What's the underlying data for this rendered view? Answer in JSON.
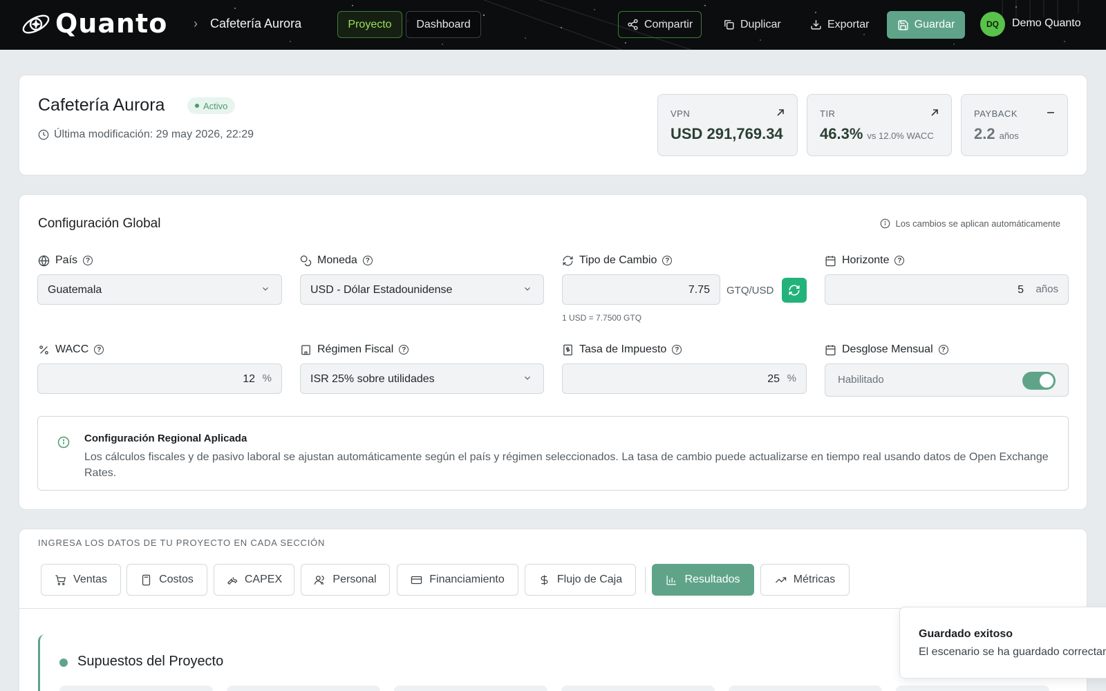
{
  "app": {
    "name": "Quanto",
    "breadcrumb_sep": "›",
    "project_name": "Cafetería Aurora"
  },
  "nav": {
    "project_tab": "Proyecto",
    "dashboard_tab": "Dashboard"
  },
  "toolbar": {
    "share": "Compartir",
    "duplicate": "Duplicar",
    "export": "Exportar",
    "save": "Guardar"
  },
  "user": {
    "initials": "DQ",
    "name": "Demo Quanto"
  },
  "project": {
    "title": "Cafetería Aurora",
    "status": "Activo",
    "last_modified": "Última modificación: 29 may 2026, 22:29"
  },
  "kpis": {
    "vpn": {
      "label": "VPN",
      "value": "USD 291,769.34",
      "icon": "arrow-up-right-icon"
    },
    "tir": {
      "label": "TIR",
      "value": "46.3%",
      "sub": "vs 12.0% WACC",
      "icon": "arrow-up-right-icon"
    },
    "payback": {
      "label": "PAYBACK",
      "value": "2.2",
      "sub": "años",
      "icon": "minus-icon"
    }
  },
  "config": {
    "title": "Configuración Global",
    "auto_note": "Los cambios se aplican automáticamente",
    "country": {
      "label": "País",
      "value": "Guatemala"
    },
    "currency": {
      "label": "Moneda",
      "value": "USD - Dólar Estadounidense"
    },
    "fx": {
      "label": "Tipo de Cambio",
      "value": "7.75",
      "unit": "GTQ/USD",
      "hint": "1 USD = 7.7500 GTQ"
    },
    "horizon": {
      "label": "Horizonte",
      "value": "5",
      "unit": "años"
    },
    "wacc": {
      "label": "WACC",
      "value": "12",
      "unit": "%"
    },
    "tax_regime": {
      "label": "Régimen Fiscal",
      "value": "ISR 25% sobre utilidades"
    },
    "tax_rate": {
      "label": "Tasa de Impuesto",
      "value": "25",
      "unit": "%"
    },
    "monthly": {
      "label": "Desglose Mensual",
      "value": "Habilitado",
      "enabled": true
    }
  },
  "info": {
    "title": "Configuración Regional Aplicada",
    "text": "Los cálculos fiscales y de pasivo laboral se ajustan automáticamente según el país y régimen seleccionados. La tasa de cambio puede actualizarse en tiempo real usando datos de Open Exchange Rates."
  },
  "sections": {
    "caption": "INGRESA LOS DATOS DE TU PROYECTO EN CADA SECCIÓN",
    "tabs": [
      "Ventas",
      "Costos",
      "CAPEX",
      "Personal",
      "Financiamiento",
      "Flujo de Caja",
      "Resultados",
      "Métricas"
    ],
    "active": "Resultados"
  },
  "assumptions": {
    "title": "Supuestos del Proyecto"
  },
  "toast": {
    "title": "Guardado exitoso",
    "text": "El escenario se ha guardado correctamente"
  },
  "colors": {
    "accent": "#5fa489",
    "brand_green": "#9be05a",
    "refresh": "#22b27a",
    "topbar": "#0b0d0e"
  }
}
